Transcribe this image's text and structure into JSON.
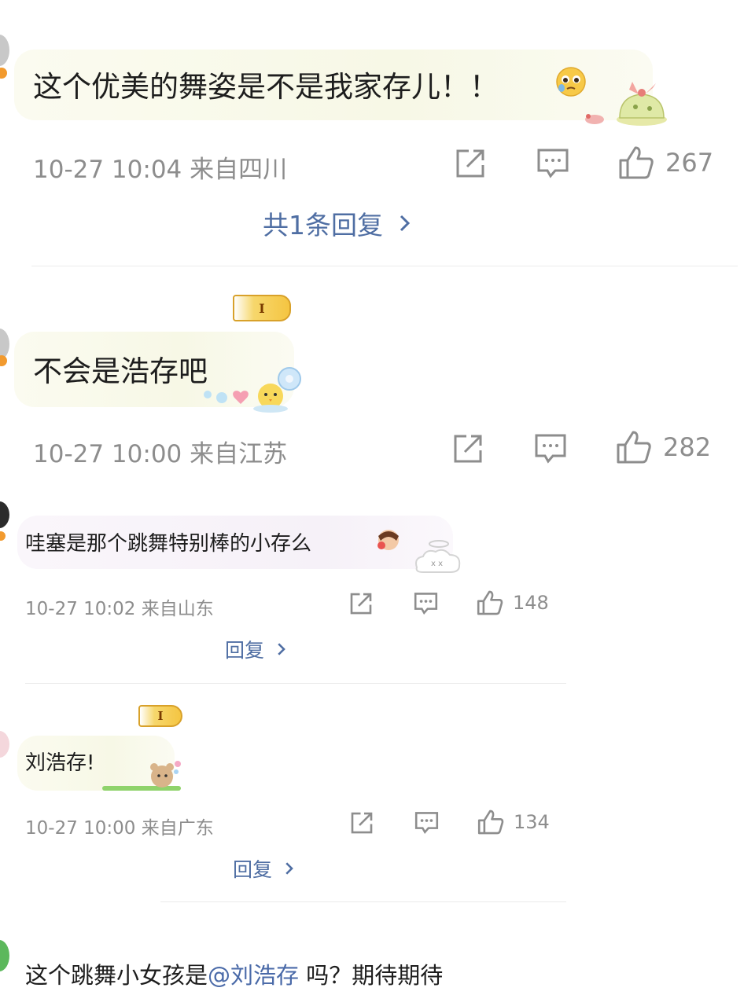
{
  "comments": [
    {
      "text": "这个优美的舞姿是不是我家存儿！！",
      "meta": "10-27 10:04  来自四川",
      "likes": "267",
      "reply": "共1条回复",
      "sticker": "pudding-sticker"
    },
    {
      "badge": "I",
      "text": "不会是浩存吧",
      "meta": "10-27 10:00  来自江苏",
      "likes": "282",
      "sticker": "chick-sticker"
    },
    {
      "text": "哇塞是那个跳舞特别棒的小存么",
      "meta": "10-27 10:02  来自山东",
      "likes": "148",
      "reply": "回复",
      "sticker": "cloud-sticker"
    },
    {
      "badge": "I",
      "text": "刘浩存!",
      "meta": "10-27 10:00  来自广东",
      "likes": "134",
      "reply": "回复",
      "sticker": "bear-sticker"
    },
    {
      "text_before": "这个跳舞小女孩是",
      "mention": "@刘浩存",
      "text_after": " 吗？期待期待"
    }
  ],
  "icons": {
    "share": "share-icon",
    "comment": "comment-icon",
    "like": "thumbs-up-icon",
    "chevron": "chevron-right-icon"
  },
  "colors": {
    "meta_text": "#8d8d8d",
    "reply_link": "#4f6ea3",
    "mention": "#4a6aa8",
    "badge_gold": "#f5c542"
  }
}
